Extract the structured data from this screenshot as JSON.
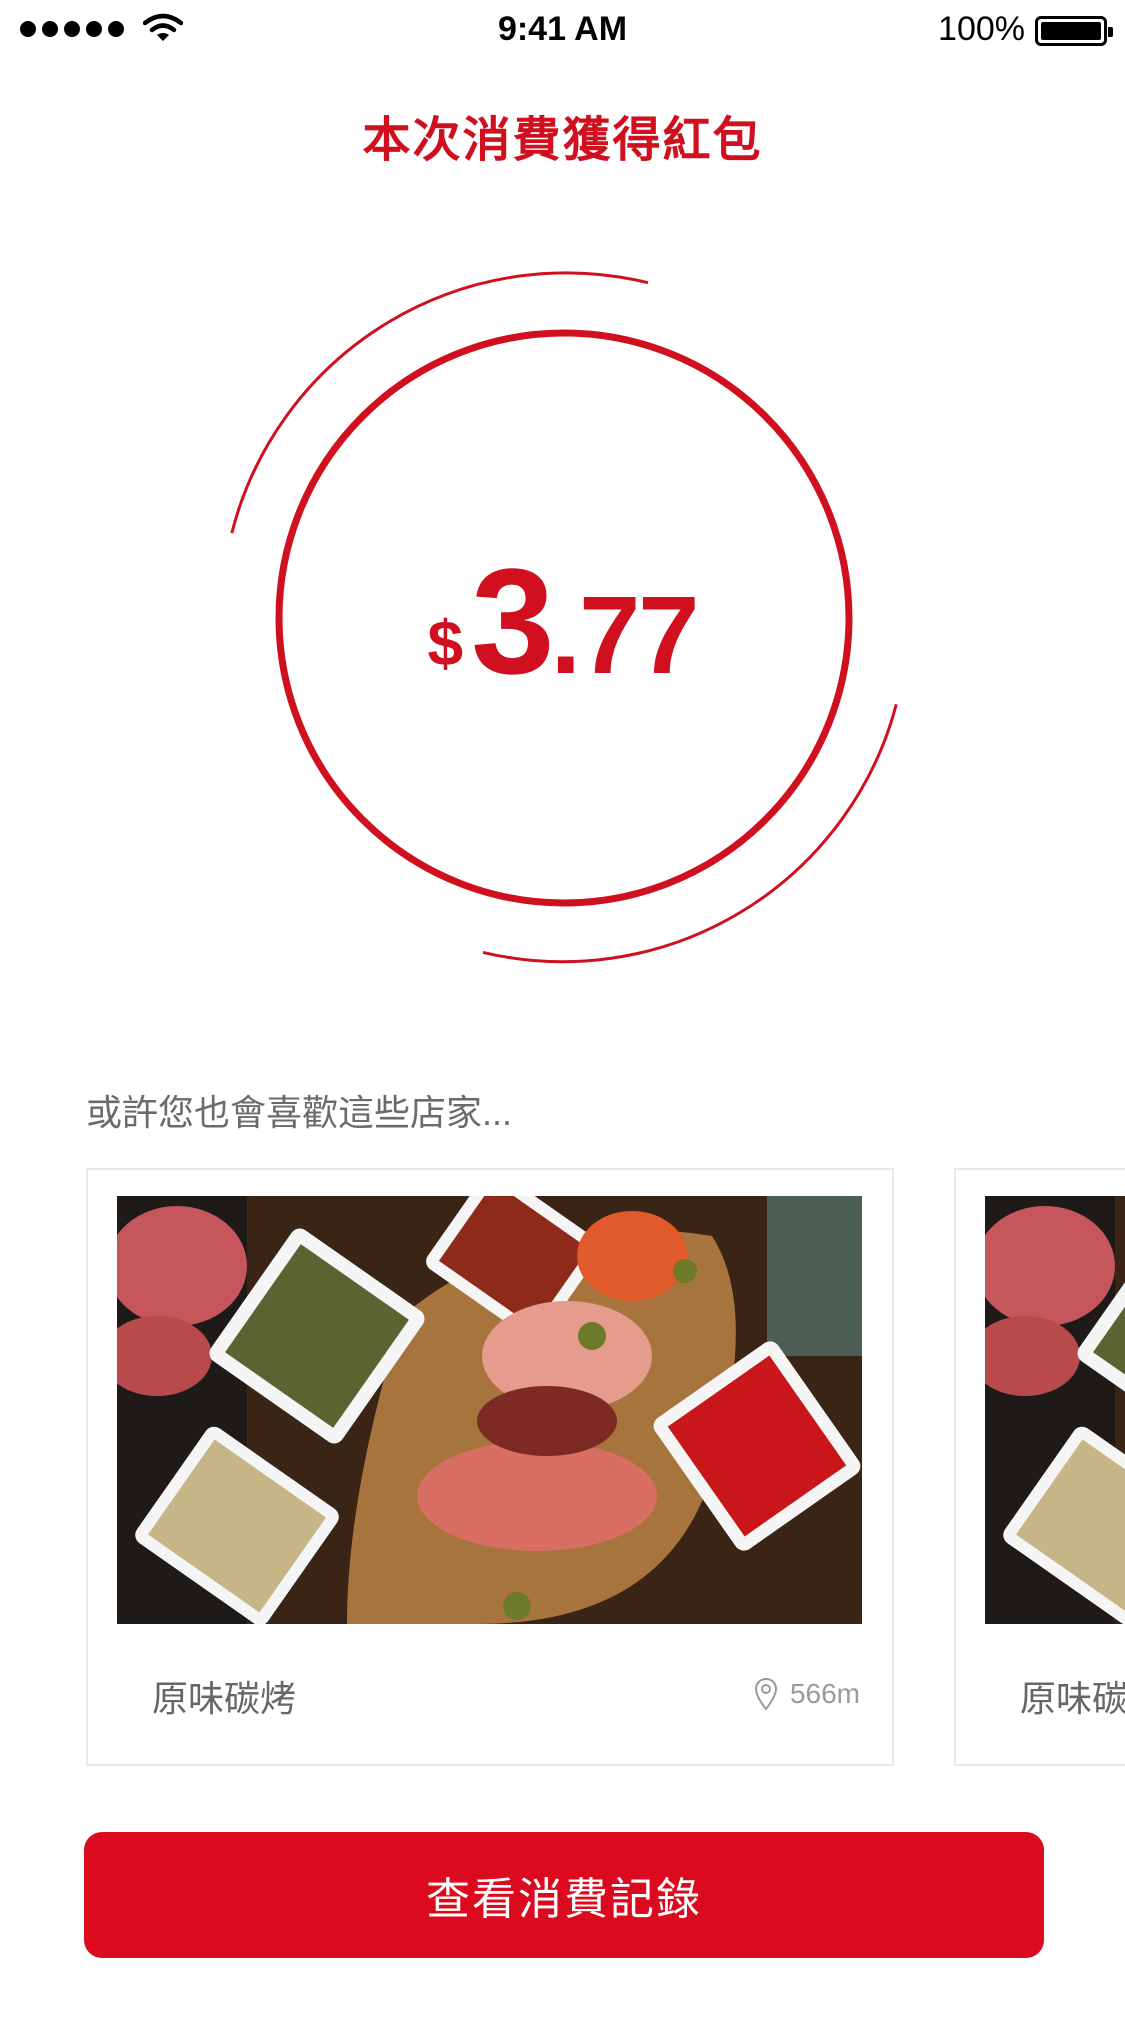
{
  "status_bar": {
    "time": "9:41 AM",
    "battery": "100%"
  },
  "header": {
    "title": "本次消費獲得紅包"
  },
  "reward": {
    "currency": "$",
    "integer": "3",
    "decimal": ".77"
  },
  "recommend": {
    "title": "或許您也會喜歡這些店家...",
    "stores": [
      {
        "name": "原味碳烤",
        "distance": "566m"
      },
      {
        "name": "原味碳烤"
      }
    ]
  },
  "cta": {
    "label": "查看消費記錄"
  },
  "colors": {
    "accent": "#d0101f",
    "button": "#dc0a1e"
  },
  "icons": [
    "signal-icon",
    "wifi-icon",
    "battery-icon",
    "location-pin-icon"
  ]
}
